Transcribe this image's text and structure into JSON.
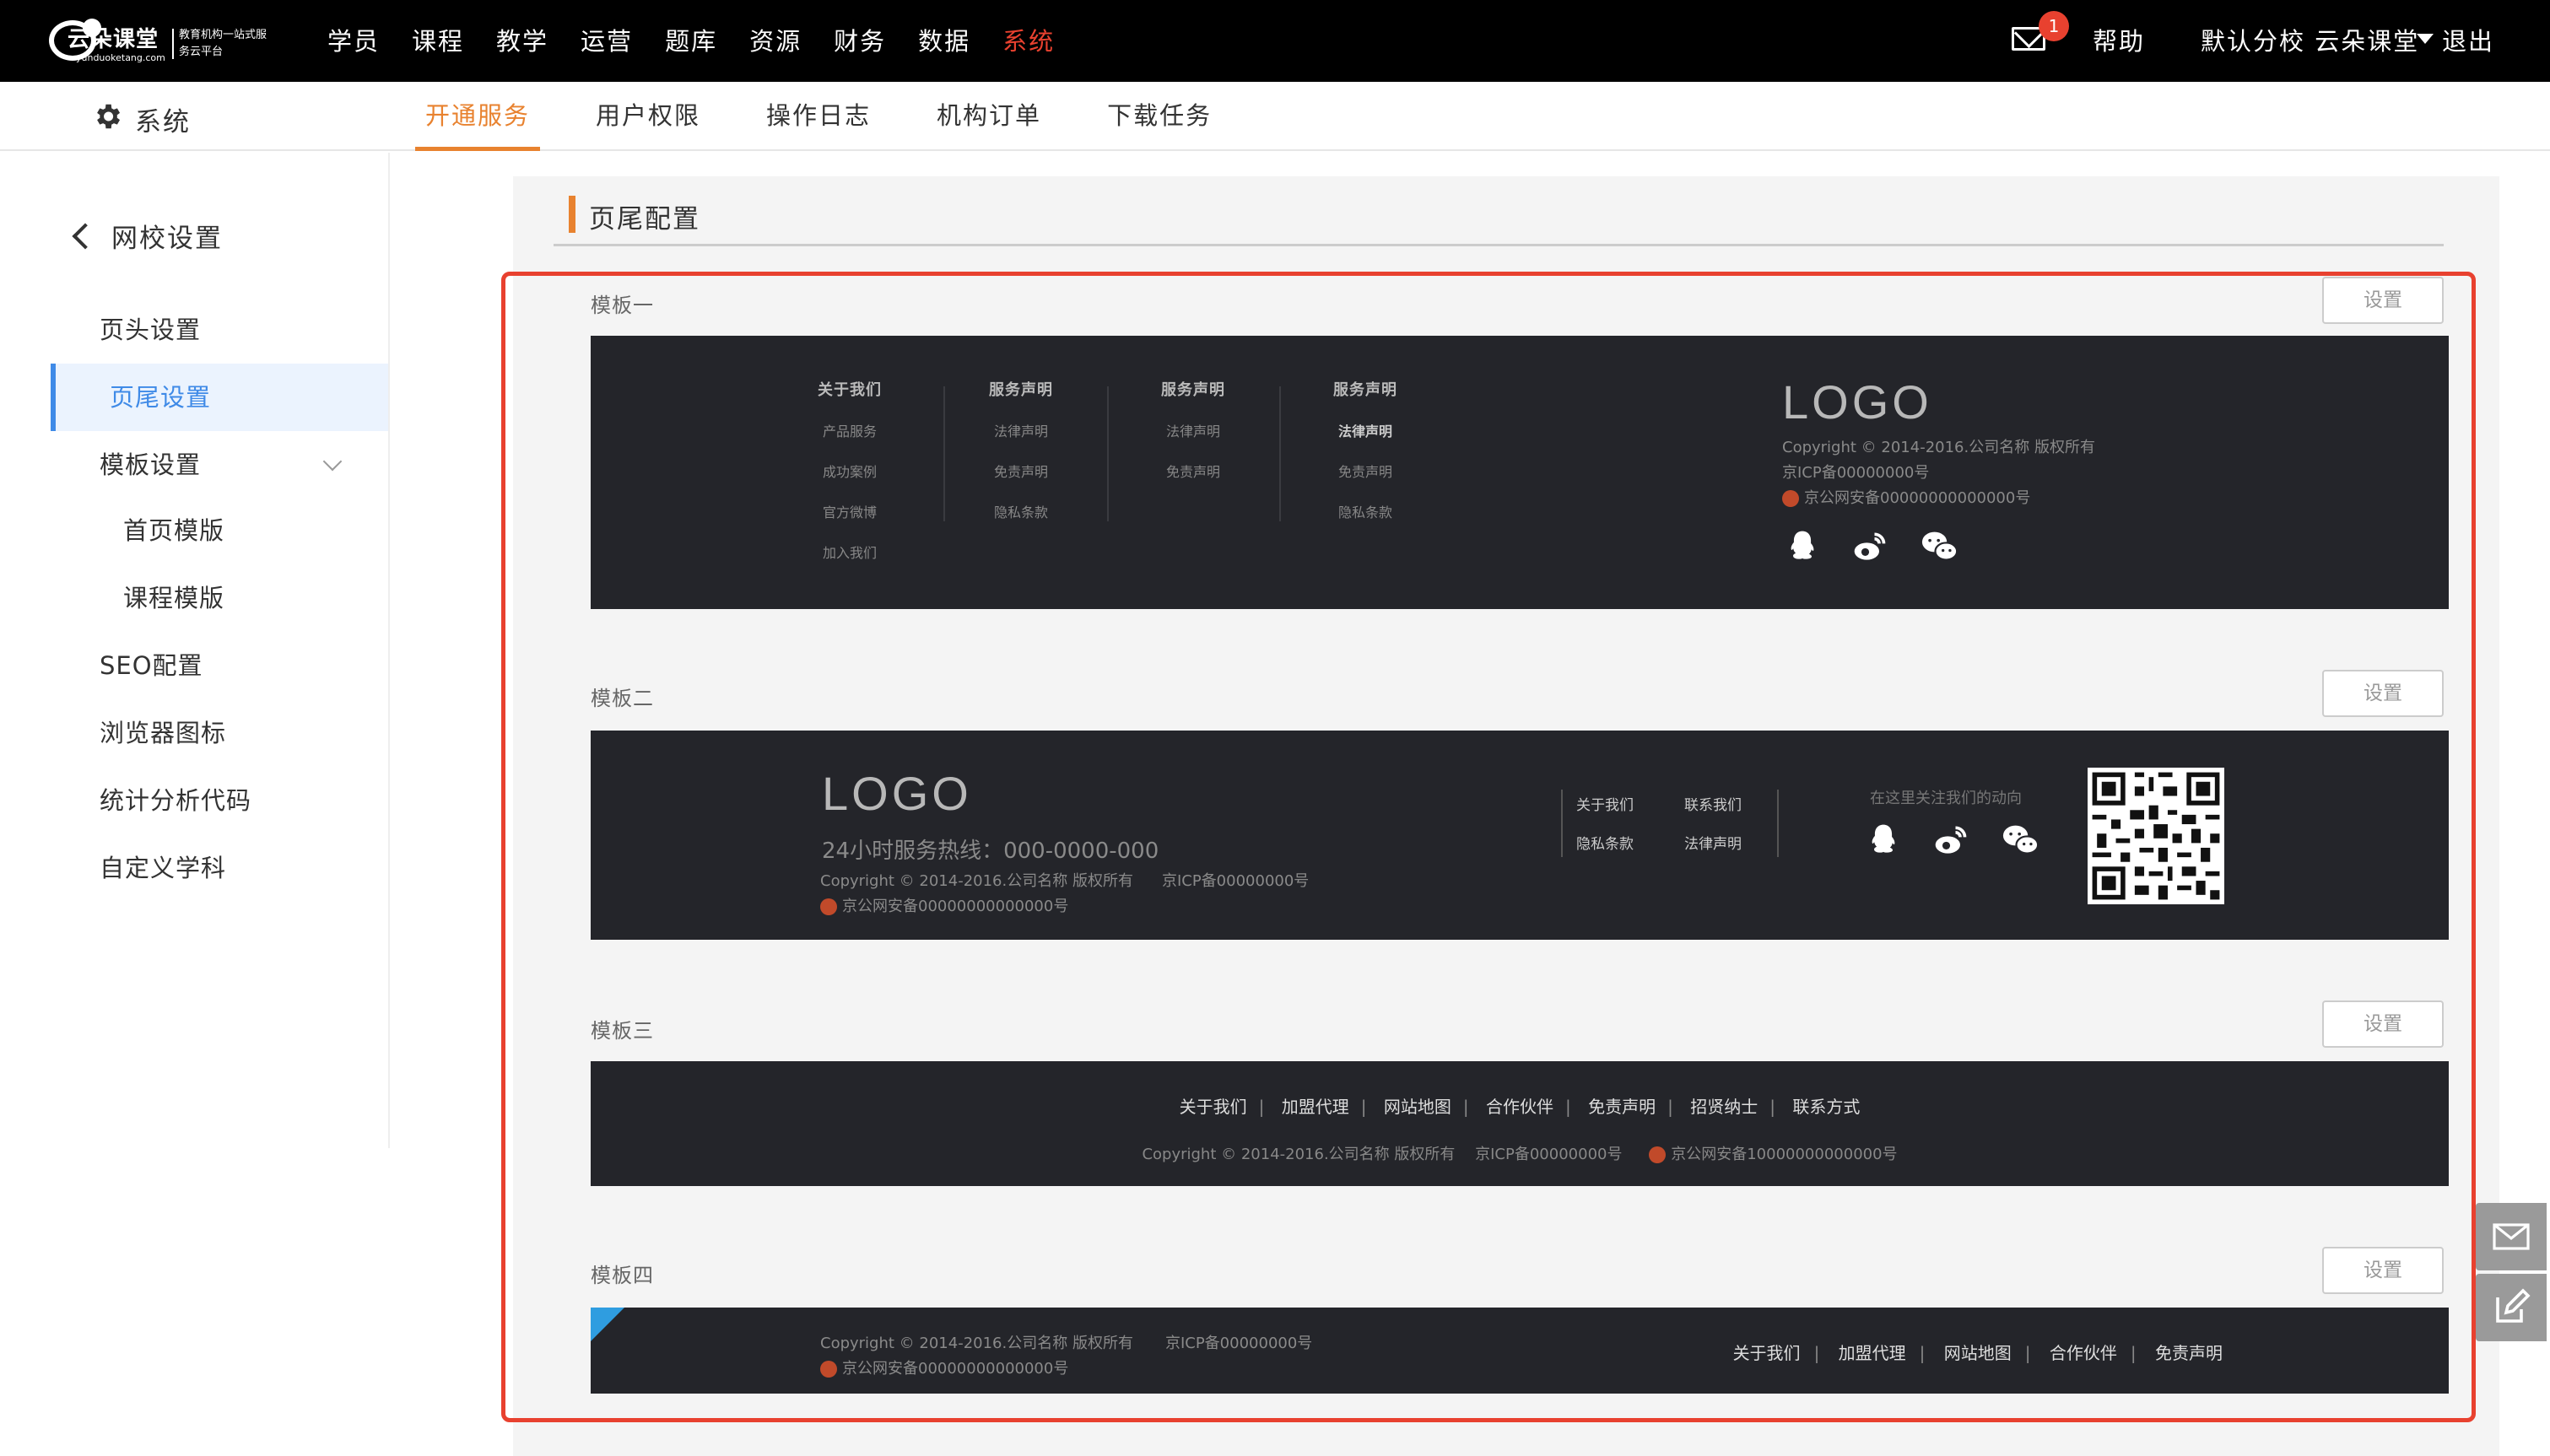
{
  "topbar": {
    "logo": {
      "name": "云朵课堂",
      "url": "yunduoketang.com",
      "tagline": "教育机构一站式服务云平台"
    },
    "nav": [
      "学员",
      "课程",
      "教学",
      "运营",
      "题库",
      "资源",
      "财务",
      "数据",
      "系统"
    ],
    "active_nav": "系统",
    "mail_count": "1",
    "help": "帮助",
    "school": "默认分校 云朵课堂",
    "logout": "退出"
  },
  "subbar": {
    "section": "系统",
    "tabs": [
      "开通服务",
      "用户权限",
      "操作日志",
      "机构订单",
      "下载任务"
    ],
    "active_tab": "开通服务"
  },
  "sidebar": {
    "back_label": "网校设置",
    "items": [
      {
        "label": "页头设置"
      },
      {
        "label": "页尾设置",
        "active": true
      },
      {
        "label": "模板设置",
        "expandable": true
      },
      {
        "label": "首页模版",
        "sub": true
      },
      {
        "label": "课程模版",
        "sub": true
      },
      {
        "label": "SEO配置"
      },
      {
        "label": "浏览器图标"
      },
      {
        "label": "统计分析代码"
      },
      {
        "label": "自定义学科"
      }
    ]
  },
  "main": {
    "title": "页尾配置",
    "set_label": "设置",
    "templates": [
      {
        "label": "模板一",
        "columns": [
          {
            "title": "关于我们",
            "items": [
              "产品服务",
              "成功案例",
              "官方微博",
              "加入我们"
            ]
          },
          {
            "title": "服务声明",
            "items": [
              "法律声明",
              "免责声明",
              "隐私条款"
            ]
          },
          {
            "title": "服务声明",
            "items": [
              "法律声明",
              "免责声明"
            ]
          },
          {
            "title": "服务声明",
            "items": [
              "法律声明",
              "免责声明",
              "隐私条款"
            ]
          }
        ],
        "logo": "LOGO",
        "copyright": "Copyright © 2014-2016.公司名称   版权所有",
        "icp": "京ICP备00000000号",
        "police": "京公网安备00000000000000号"
      },
      {
        "label": "模板二",
        "logo": "LOGO",
        "hotline": "24小时服务热线：000-0000-000",
        "copyright": "Copyright © 2014-2016.公司名称   版权所有",
        "icp": "京ICP备00000000号",
        "police": "京公网安备00000000000000号",
        "links": [
          "关于我们",
          "联系我们",
          "隐私条款",
          "法律声明"
        ],
        "follow": "在这里关注我们的动向"
      },
      {
        "label": "模板三",
        "links": [
          "关于我们",
          "加盟代理",
          "网站地图",
          "合作伙伴",
          "免责声明",
          "招贤纳士",
          "联系方式"
        ],
        "copyright": "Copyright © 2014-2016.公司名称   版权所有",
        "icp": "京ICP备00000000号",
        "police": "京公网安备10000000000000号"
      },
      {
        "label": "模板四",
        "copyright": "Copyright © 2014-2016.公司名称   版权所有",
        "icp": "京ICP备00000000号",
        "police": "京公网安备00000000000000号",
        "links": [
          "关于我们",
          "加盟代理",
          "网站地图",
          "合作伙伴",
          "免责声明"
        ]
      }
    ]
  },
  "colors": {
    "accent": "#e8822f",
    "alert": "#e8412f",
    "active_blue": "#3f8ae7",
    "footer_bg": "#24252a"
  }
}
